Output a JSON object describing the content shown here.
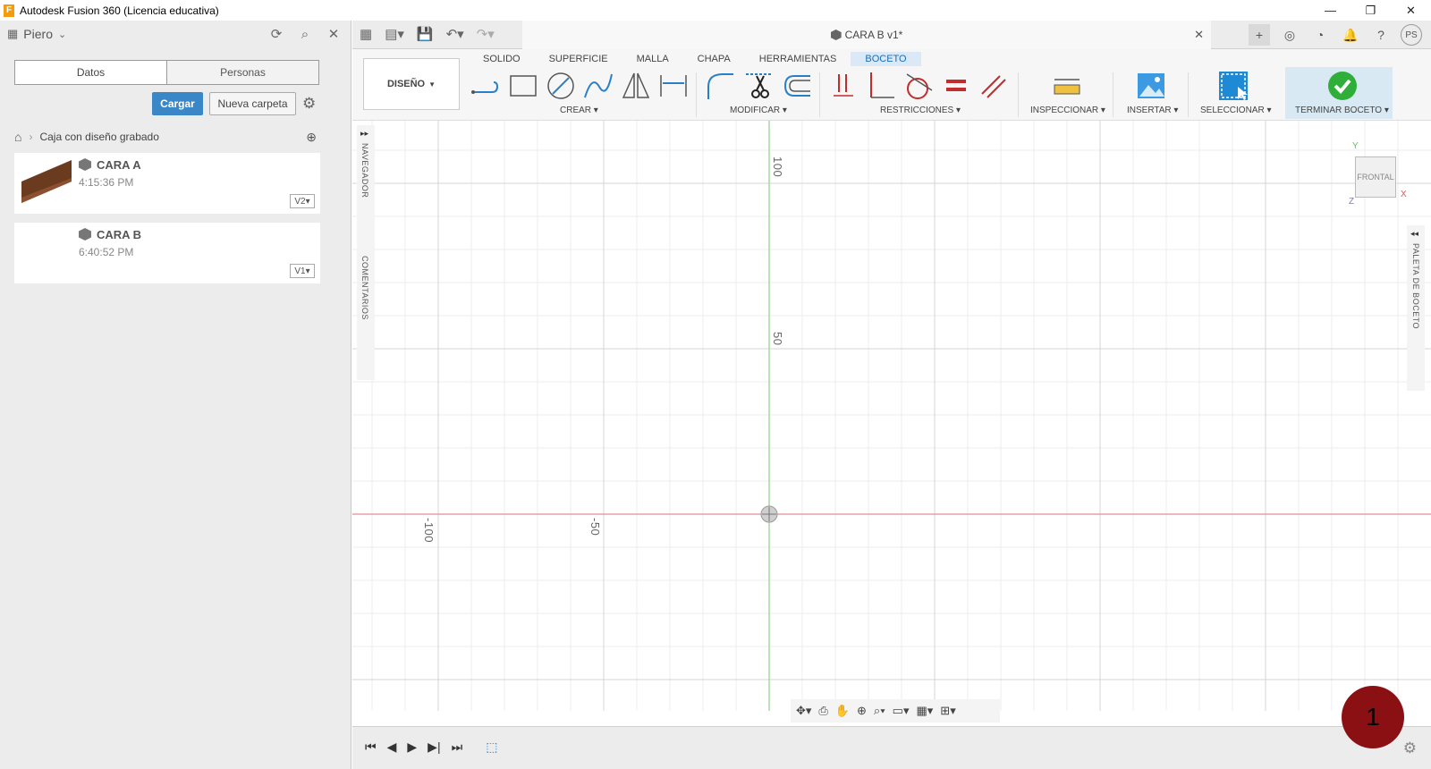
{
  "window": {
    "title": "Autodesk Fusion 360 (Licencia educativa)",
    "app_icon_letter": "F"
  },
  "data_panel": {
    "user": "Piero",
    "tabs": [
      "Datos",
      "Personas"
    ],
    "upload_label": "Cargar",
    "new_folder_label": "Nueva carpeta",
    "breadcrumb": "Caja con diseño grabado",
    "files": [
      {
        "name": "CARA A",
        "time": "4:15:36 PM",
        "version": "V2▾",
        "has_thumb": true
      },
      {
        "name": "CARA B",
        "time": "6:40:52 PM",
        "version": "V1▾",
        "has_thumb": false
      }
    ]
  },
  "document": {
    "tab_title": "CARA B v1*",
    "user_initials": "PS"
  },
  "ribbon": {
    "workspace": "DISEÑO",
    "tabs": [
      "SOLIDO",
      "SUPERFICIE",
      "MALLA",
      "CHAPA",
      "HERRAMIENTAS",
      "BOCETO"
    ],
    "active_tab": "BOCETO",
    "groups": {
      "crear": "CREAR",
      "modificar": "MODIFICAR",
      "restricciones": "RESTRICCIONES",
      "inspeccionar": "INSPECCIONAR",
      "insertar": "INSERTAR",
      "seleccionar": "SELECCIONAR",
      "terminar": "TERMINAR BOCETO"
    }
  },
  "canvas": {
    "navigator_label": "NAVEGADOR",
    "comments_label": "COMENTARIOS",
    "palette_label": "PALETA DE BOCETO",
    "viewcube_label": "FRONTAL",
    "axis_labels": {
      "y": "Y",
      "x": "X",
      "z": "Z"
    },
    "rulers": {
      "v100": "100",
      "v50": "50",
      "hm100": "-100",
      "hm50": "-50"
    }
  },
  "badge": "1",
  "colors": {
    "accent": "#3a87c8",
    "x_axis": "#e6a0a8",
    "y_axis": "#a6d8a6",
    "terminar_check": "#2fae3a",
    "badge": "#8b1013"
  }
}
